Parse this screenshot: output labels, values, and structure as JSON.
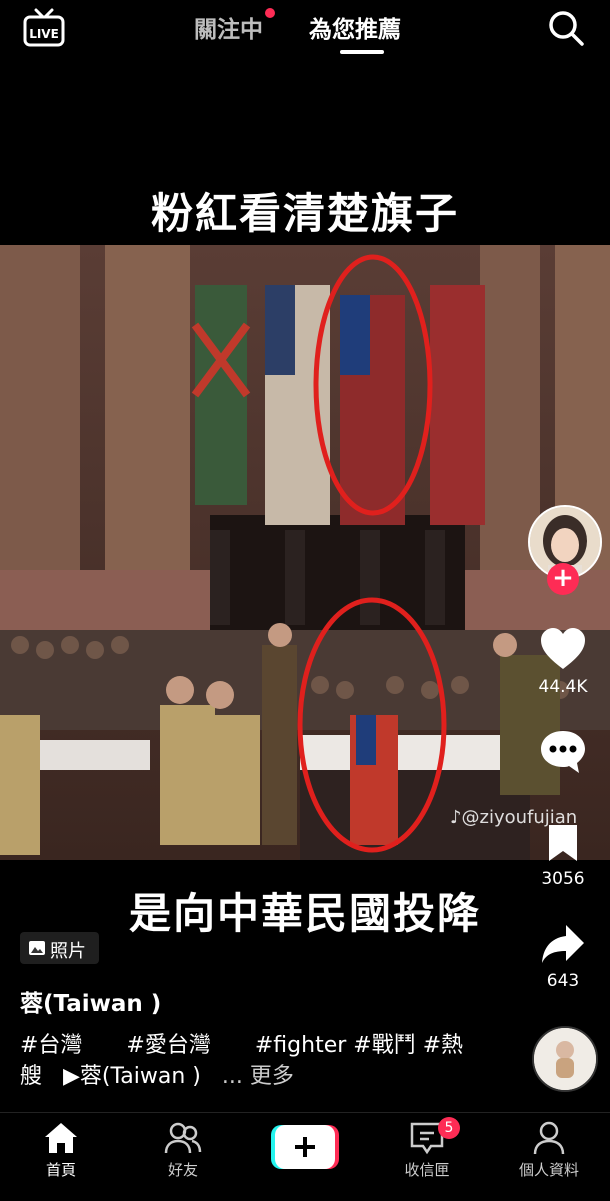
{
  "top_nav": {
    "live_label": "LIVE",
    "tab_following": "關注中",
    "tab_foryou": "為您推薦"
  },
  "video": {
    "overlay_top": "粉紅看清楚旗子",
    "overlay_bottom": "是向中華民國投降",
    "watermark": "@ziyoufujian"
  },
  "right_actions": {
    "likes": "44.4K",
    "bookmarks": "3056",
    "shares": "643"
  },
  "post": {
    "photo_label": "照片",
    "author": "蓉(Taiwan )",
    "caption_line1": "#台灣　　#愛台灣　　#fighter #戰鬥 #熱",
    "caption_line2_tag": "艘",
    "caption_sound": "▶蓉(Taiwan )",
    "caption_more": "... 更多"
  },
  "bottom_nav": {
    "home": "首頁",
    "friends": "好友",
    "inbox": "收信匣",
    "inbox_badge": "5",
    "profile": "個人資料"
  },
  "colors": {
    "accent": "#fe2c55",
    "background": "#000000",
    "create_cyan": "#25f4ee"
  }
}
